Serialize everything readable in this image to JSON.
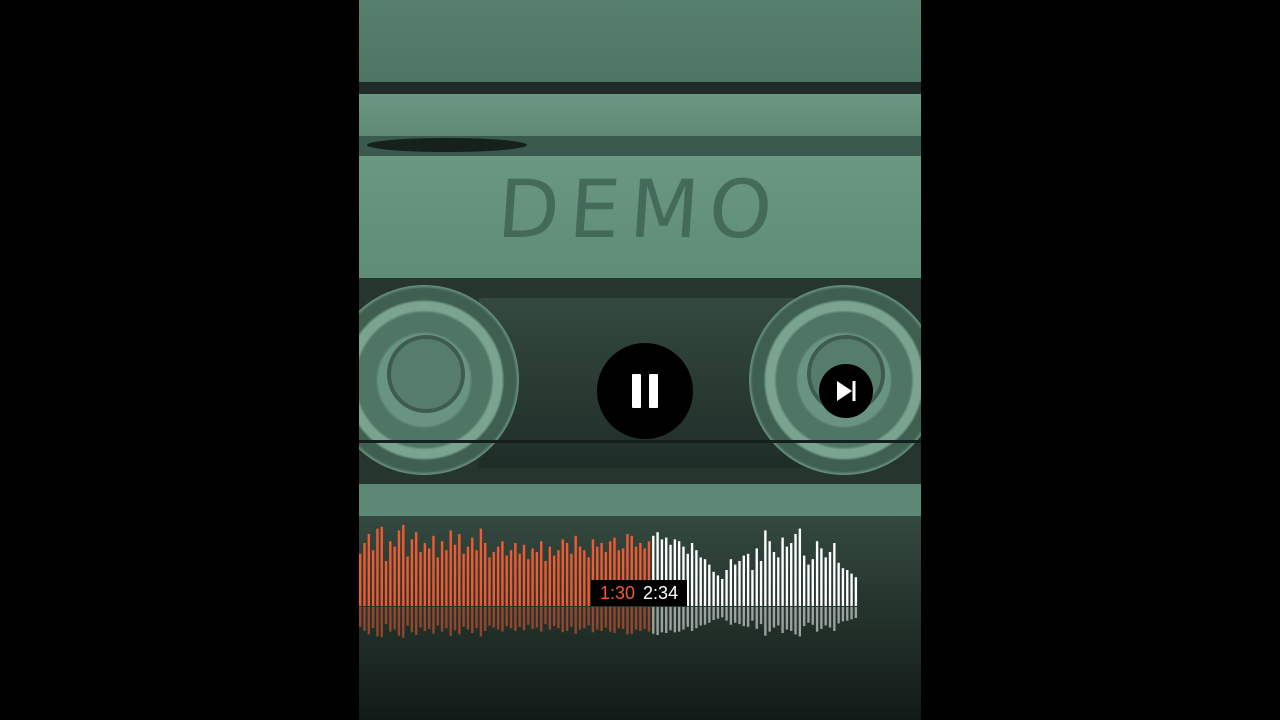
{
  "video": {
    "label_text": "DEMO"
  },
  "controls": {
    "pause_icon": "pause-icon",
    "next_icon": "skip-next-icon"
  },
  "playback": {
    "current_time": "1:30",
    "total_time": "2:34",
    "progress_fraction": 0.584
  },
  "colors": {
    "played": "#f35a31",
    "unplayed": "#ffffff",
    "background": "#000000"
  },
  "waveform": {
    "bar_heights": [
      58,
      70,
      80,
      62,
      86,
      88,
      50,
      72,
      66,
      84,
      90,
      55,
      74,
      82,
      60,
      70,
      64,
      78,
      54,
      72,
      62,
      84,
      68,
      80,
      58,
      66,
      76,
      62,
      86,
      70,
      54,
      60,
      66,
      72,
      56,
      62,
      70,
      58,
      68,
      52,
      64,
      60,
      72,
      50,
      66,
      56,
      62,
      74,
      70,
      58,
      78,
      66,
      62,
      54,
      74,
      66,
      70,
      60,
      72,
      76,
      62,
      64,
      80,
      78,
      66,
      70,
      64,
      72,
      78,
      82,
      74,
      76,
      68,
      74,
      72,
      66,
      58,
      70,
      62,
      54,
      52,
      46,
      38,
      34,
      30,
      40,
      52,
      46,
      50,
      56,
      58,
      40,
      64,
      50,
      84,
      72,
      60,
      54,
      76,
      66,
      70,
      80,
      86,
      56,
      46,
      52,
      72,
      64,
      54,
      60,
      70,
      48,
      42,
      40,
      36,
      32
    ]
  }
}
